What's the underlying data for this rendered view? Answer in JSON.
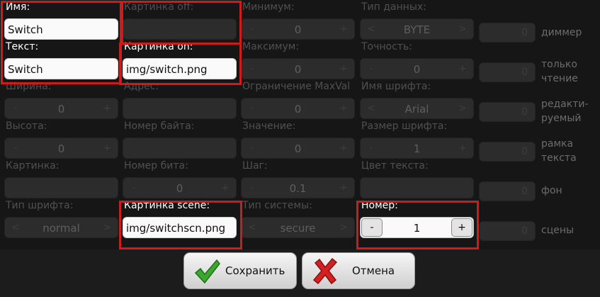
{
  "form": {
    "name": {
      "label": "Имя:",
      "value": "Switch"
    },
    "text": {
      "label": "Текст:",
      "value": "Switch"
    },
    "width": {
      "label": "Ширина:",
      "value": "0",
      "minus": "-",
      "plus": "+"
    },
    "height": {
      "label": "Высота:",
      "value": "0",
      "minus": "-",
      "plus": "+"
    },
    "picture": {
      "label": "Картинка:",
      "value": ""
    },
    "font_type": {
      "label": "Тип шрифта:",
      "value": "normal",
      "prev": "<",
      "next": ">"
    },
    "picture_off": {
      "label": "Картинка off:",
      "value": ""
    },
    "picture_on": {
      "label": "Картинка on:",
      "value": "img/switch.png"
    },
    "address": {
      "label": "Адрес:",
      "value": ""
    },
    "byte_number": {
      "label": "Номер байта:",
      "value": ""
    },
    "bit_number": {
      "label": "Номер бита:",
      "value": "0",
      "minus": "-",
      "plus": "+"
    },
    "picture_scene": {
      "label": "Картинка scene:",
      "value": "img/switchscn.png"
    },
    "minimum": {
      "label": "Минимум:",
      "value": "0",
      "minus": "-",
      "plus": "+"
    },
    "maximum": {
      "label": "Максимум:",
      "value": "0",
      "minus": "-",
      "plus": "+"
    },
    "limit_maxval": {
      "label": "Ограничение MaxVal",
      "value": "0",
      "minus": "-",
      "plus": "+"
    },
    "value": {
      "label": "Значение:",
      "value": "0",
      "minus": "-",
      "plus": "+"
    },
    "step": {
      "label": "Шаг:",
      "value": "0.1",
      "minus": "-",
      "plus": "+"
    },
    "system_type": {
      "label": "Тип системы:",
      "value": "secure",
      "prev": "<",
      "next": ">"
    },
    "data_type": {
      "label": "Тип данных:",
      "value": "BYTE",
      "prev": "<",
      "next": ">"
    },
    "precision": {
      "label": "Точность:",
      "value": "0",
      "minus": "-",
      "plus": "+"
    },
    "font_name": {
      "label": "Имя шрифта:",
      "value": "Arial",
      "prev": "<",
      "next": ">"
    },
    "font_size": {
      "label": "Размер шрифта:",
      "value": "1",
      "minus": "-",
      "plus": "+"
    },
    "text_color": {
      "label": "Цвет текста:",
      "value": ""
    },
    "number": {
      "label": "Номер:",
      "value": "1",
      "minus": "-",
      "plus": "+"
    }
  },
  "checks": {
    "dimmer": {
      "label": "диммер",
      "value": "0"
    },
    "readonly": {
      "label": "только чтение",
      "value": "0"
    },
    "editable": {
      "label": "редакти-руемый",
      "value": "0"
    },
    "text_frame": {
      "label": "рамка текста",
      "value": "0"
    },
    "background": {
      "label": "фон",
      "value": "0"
    },
    "scenes": {
      "label": "сцены",
      "value": "0"
    }
  },
  "buttons": {
    "save": "Сохранить",
    "cancel": "Отмена"
  },
  "colors": {
    "highlight": "#d11a1a",
    "check_icon": "#3aa82e",
    "cross_icon": "#d42020"
  }
}
